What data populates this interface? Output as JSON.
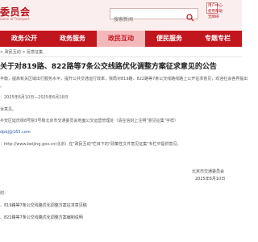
{
  "header": {
    "logo_text": "委员会",
    "logo_sub": "ission of Transport",
    "search_placeholder": "搜索新闻",
    "quick_links": [
      "用户中心",
      "使用帮助",
      "无障碍"
    ]
  },
  "nav": {
    "items": [
      {
        "label": "政务公开",
        "active": false
      },
      {
        "label": "政务服务",
        "active": false
      },
      {
        "label": "政民互动",
        "active": true
      },
      {
        "label": "便民服务",
        "active": false
      },
      {
        "label": "专题专栏",
        "active": false
      }
    ]
  },
  "breadcrumb": "> 政民互动 > 民意征集",
  "article": {
    "title": "关于对819路、822路等7条公交线路优化调整方案征求意见的公告",
    "para1_line1": "平衡，提高有关区域出行服务水平，提升公共交通运行效率，我局对819路、822路等7条公交线路线路上公开征求意见，欢迎社会各界提出",
    "para1_line2": "。",
    "date_range": "：2025年6月10日—2025年6月16日",
    "para2": "诉意见。",
    "channel1": "平安区延庆街8号院3号楼北京市交通委员会地面公交运营管理处（请在信封上注明\"意见征集\"字样）",
    "channel2": "dpbj@163.com",
    "channel3_prefix": "：http://www.beijing.gov.cn(北京）在\"政民互动\"栏目下的\"政策性文件意见征集\"专栏中提供意见。",
    "signature_org": "北京市交通委员会",
    "signature_date": "2025年6月10日"
  },
  "attachments": {
    "label": "附：",
    "items": [
      "、819路等7条公交线路优化调整方案征求意见稿",
      "、822路等7条公交线路优化调整方案编制说明"
    ]
  }
}
